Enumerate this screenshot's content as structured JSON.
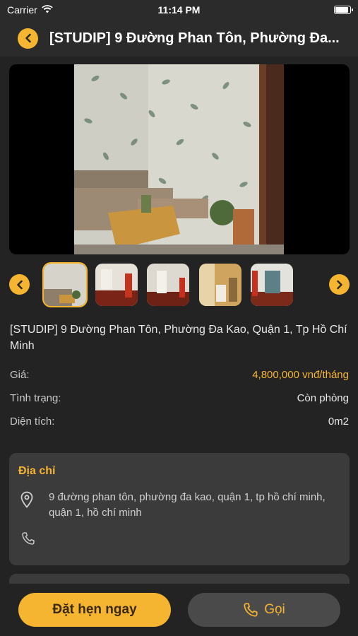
{
  "status_bar": {
    "carrier": "Carrier",
    "time": "11:14 PM",
    "battery_level": 0.95
  },
  "nav": {
    "title": "[STUDIP] 9 Đường Phan Tôn, Phường Đa..."
  },
  "gallery": {
    "thumbnail_count": 5,
    "selected_index": 0
  },
  "listing": {
    "title": "[STUDIP] 9 Đường Phan Tôn, Phường Đa Kao, Quận 1, Tp Hồ Chí Minh",
    "price_label": "Giá:",
    "price_value": "4,800,000 vnđ/tháng",
    "status_label": "Tình trạng:",
    "status_value": "Còn phòng",
    "area_label": "Diện tích:",
    "area_value": "0m2"
  },
  "address_card": {
    "title": "Địa chỉ",
    "address": "9 đường phan tôn, phường đa kao, quận 1, tp hồ chí minh, quận 1, hồ chí minh"
  },
  "actions": {
    "book_label": "Đặt hẹn ngay",
    "call_label": "Gọi"
  },
  "colors": {
    "accent": "#f6b531",
    "background": "#232323",
    "card": "#3b3b3b"
  }
}
